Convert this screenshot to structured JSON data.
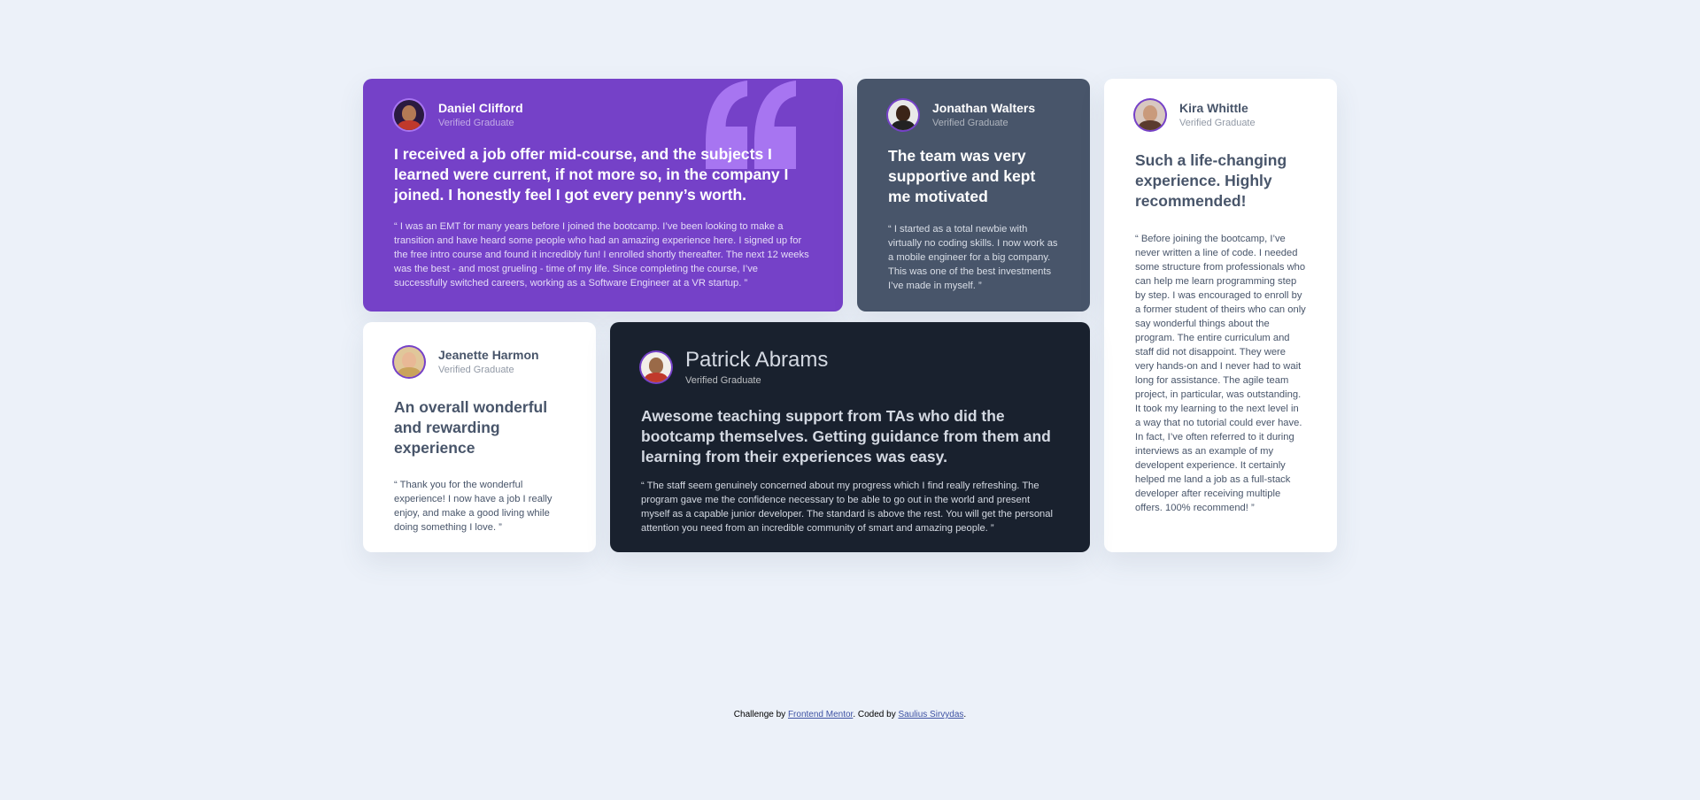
{
  "testimonials": [
    {
      "name": "Daniel Clifford",
      "role": "Verified Graduate",
      "headline": "I received a job offer mid-course, and the subjects I learned were current, if not more so, in the company I joined. I honestly feel I got every penny’s worth.",
      "body": "“ I was an EMT for many years before I joined the bootcamp. I’ve been looking to make a transition and have heard some people who had an amazing experience here. I signed up for the free intro course and found it incredibly fun! I enrolled shortly thereafter. The next 12 weeks was the best - and most grueling - time of my life. Since completing the course, I’ve successfully switched careers, working as a Software Engineer at a VR startup. ”",
      "color": "#7541c8"
    },
    {
      "name": "Jonathan Walters",
      "role": "Verified Graduate",
      "headline": "The team was very supportive and kept me motivated",
      "body": "“ I started as a total newbie with virtually no coding skills. I now work as a mobile engineer for a big company. This was one of the best investments I’ve made in myself. ”",
      "color": "#48556a"
    },
    {
      "name": "Kira Whittle",
      "role": "Verified Graduate",
      "headline": "Such a life-changing experience. Highly recommended!",
      "body": "“ Before joining the bootcamp, I’ve never written a line of code. I needed some structure from professionals who can help me learn programming step by step. I was encouraged to enroll by a former student of theirs who can only say wonderful things about the program. The entire curriculum and staff did not disappoint. They were very hands-on and I never had to wait long for assistance. The agile team project, in particular, was outstanding. It took my learning to the next level in a way that no tutorial could ever have. In fact, I’ve often referred to it during interviews as an example of my developent experience. It certainly helped me land a job as a full-stack developer after receiving multiple offers. 100% recommend! ”",
      "color": "#ffffff"
    },
    {
      "name": "Jeanette Harmon",
      "role": "Verified Graduate",
      "headline": "An overall wonderful and rewarding experience",
      "body": "“ Thank you for the wonderful experience! I now have a job I really enjoy, and make a good living while doing something I love. ”",
      "color": "#ffffff"
    },
    {
      "name": "Patrick Abrams",
      "role": "Verified Graduate",
      "headline": "Awesome teaching support from TAs who did the bootcamp themselves. Getting guidance from them and learning from their experiences was easy.",
      "body": "“ The staff seem genuinely concerned about my progress which I find really refreshing. The program gave me the confidence necessary to be able to go out in the world and present myself as a capable junior developer. The standard is above the rest. You will get the personal attention you need from an incredible community of smart and amazing people. ”",
      "color": "#19212e"
    }
  ],
  "attribution": {
    "prefix": "Challenge by ",
    "link1": "Frontend Mentor",
    "middle": ". Coded by ",
    "link2": "Saulius Sirvydas",
    "suffix": "."
  },
  "colors": {
    "background": "#ecf1f9",
    "accent": "#7541c8",
    "quote_mark": "#a775f1"
  }
}
